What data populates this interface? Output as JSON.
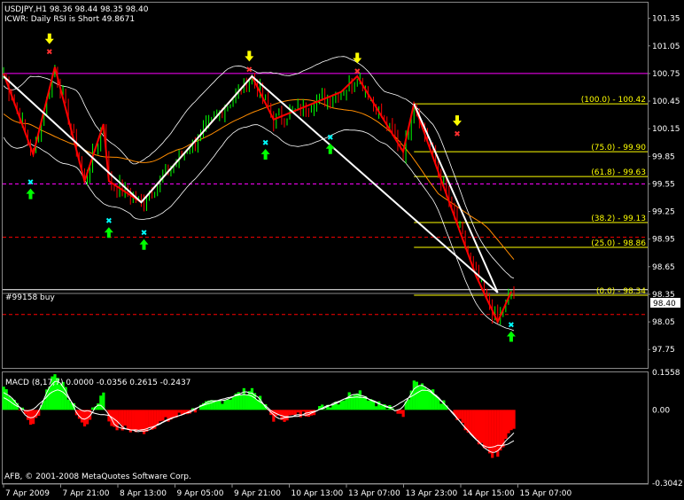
{
  "header": {
    "line1": "USDJPY,H1  98.36 98.44 98.35 98.40",
    "line2": "ICWR: Daily RSI is Short 49.8671"
  },
  "order_label": "#99158 buy",
  "copyright": "AFB, © 2001-2008 MetaQuotes Software Corp.",
  "macd_label": "MACD  (8,17,7) 0.0000 -0.0356  0.2615 -0.2437",
  "colors": {
    "background": "#000000",
    "bull_candle": "#00ff00",
    "bear_candle": "#ff0000",
    "zigzag": "#ff0000",
    "wave_line": "#ffffff",
    "fib": "#ffff00",
    "magenta_line": "#ff00ff",
    "ma_orange": "#ff8c00",
    "bands": "#ffffff",
    "up_arrow": "#00ff00",
    "down_arrow": "#ffff00",
    "macd_pos": "#00ff00",
    "macd_neg": "#ff0000"
  },
  "chart_data": [
    {
      "type": "candlestick",
      "title": "USDJPY,H1",
      "ylim": [
        97.55,
        101.52
      ],
      "y_ticks": [
        "101.35",
        "101.05",
        "100.75",
        "100.45",
        "100.15",
        "99.85",
        "99.55",
        "99.25",
        "98.95",
        "98.65",
        "98.35",
        "98.05",
        "97.75"
      ],
      "y_tick_values": [
        101.35,
        101.05,
        100.75,
        100.45,
        100.15,
        99.85,
        99.55,
        99.25,
        98.95,
        98.65,
        98.35,
        98.05,
        97.75
      ],
      "x_labels": [
        "7 Apr 2009",
        "7 Apr 21:00",
        "8 Apr 13:00",
        "9 Apr 05:00",
        "9 Apr 21:00",
        "10 Apr 13:00",
        "13 Apr 07:00",
        "13 Apr 23:00",
        "14 Apr 15:00",
        "15 Apr 07:00"
      ],
      "bar_count": 190,
      "current_price": "98.40",
      "zigzag_points": [
        [
          0,
          100.75
        ],
        [
          11,
          99.87
        ],
        [
          19,
          100.82
        ],
        [
          30,
          99.58
        ],
        [
          37,
          100.2
        ],
        [
          39,
          99.58
        ],
        [
          51,
          99.35
        ],
        [
          92,
          100.72
        ],
        [
          100,
          100.25
        ],
        [
          125,
          100.55
        ],
        [
          131,
          100.72
        ],
        [
          148,
          99.9
        ],
        [
          152,
          100.42
        ],
        [
          162,
          99.6
        ],
        [
          175,
          98.55
        ],
        [
          183,
          98.05
        ],
        [
          188,
          98.38
        ]
      ],
      "wave_points": [
        [
          0,
          100.72
        ],
        [
          51,
          99.35
        ],
        [
          92,
          100.72
        ],
        [
          183,
          98.37
        ],
        [
          152,
          100.42
        ]
      ],
      "fibonacci": [
        {
          "label": "(100.0) - 100.42",
          "value": 100.42
        },
        {
          "label": "(75.0) - 99.90",
          "value": 99.9
        },
        {
          "label": "(61.8) - 99.63",
          "value": 99.63
        },
        {
          "label": "(38.2) - 99.13",
          "value": 99.13
        },
        {
          "label": "(25.0) - 98.86",
          "value": 98.86
        },
        {
          "label": "(0.0) - 98.34",
          "value": 98.34
        }
      ],
      "horizontal_lines": [
        {
          "value": 100.75,
          "color": "#ff00ff",
          "style": "solid"
        },
        {
          "value": 99.55,
          "color": "#ff00ff",
          "style": "dashed"
        },
        {
          "value": 98.97,
          "color": "#ff0000",
          "style": "dashed"
        },
        {
          "value": 98.4,
          "color": "#ffffff",
          "style": "solid"
        },
        {
          "value": 98.36,
          "color": "#888888",
          "style": "solid"
        },
        {
          "value": 98.13,
          "color": "#ff0000",
          "style": "dashed"
        }
      ],
      "up_arrows": [
        [
          10,
          99.5
        ],
        [
          39,
          99.08
        ],
        [
          52,
          98.95
        ],
        [
          97,
          99.93
        ],
        [
          121,
          99.99
        ],
        [
          188,
          97.95
        ]
      ],
      "down_arrows": [
        [
          17,
          101.07
        ],
        [
          91,
          100.88
        ],
        [
          131,
          100.86
        ],
        [
          168,
          100.18
        ]
      ]
    },
    {
      "type": "bar",
      "title": "MACD (8,17,7)",
      "values_shown": [
        0.0,
        -0.0356,
        0.2615,
        -0.2437
      ],
      "ylim": [
        -0.3042,
        0.1558
      ],
      "y_ticks": [
        "0.1558",
        "0.00",
        "-0.3042"
      ],
      "y_tick_values": [
        0.1558,
        0.0,
        -0.3042
      ]
    }
  ]
}
